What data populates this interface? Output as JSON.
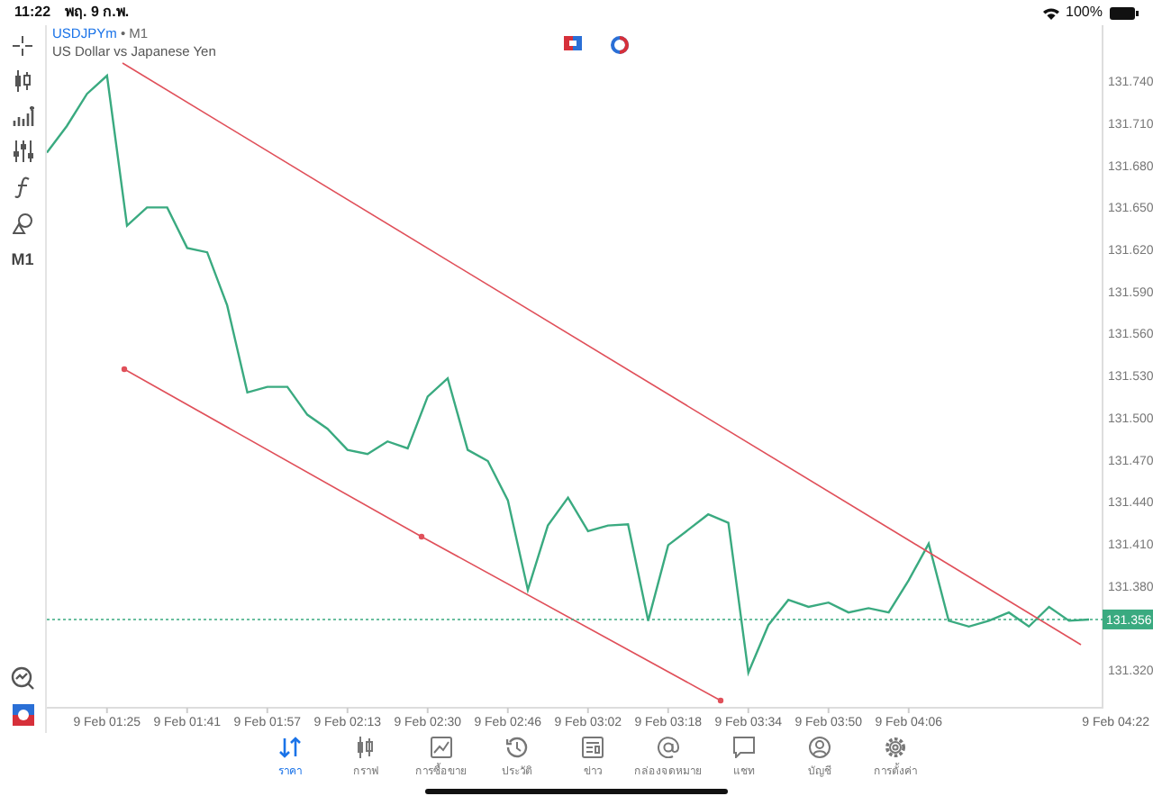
{
  "status_bar": {
    "time": "11:22",
    "date": "พฤ. 9 ก.พ.",
    "battery": "100%"
  },
  "left_toolbar": {
    "timeframe": "M1"
  },
  "chart": {
    "timeframe": "• M1",
    "description": "US Dollar vs Japanese Yen",
    "current_price": "131.356",
    "last_time_label": "9 Feb 04:22",
    "trend_lines": [
      {
        "color": "#e0505a",
        "anchors": false
      },
      {
        "color": "#e0505a",
        "anchors": true
      }
    ],
    "chart_data": {
      "type": "line",
      "ylim": [
        131.293,
        131.78
      ],
      "categories": [
        null,
        null,
        null,
        "9 Feb 01:25",
        null,
        null,
        null,
        "9 Feb 01:41",
        null,
        null,
        null,
        "9 Feb 01:57",
        null,
        null,
        null,
        "9 Feb 02:13",
        null,
        null,
        null,
        "9 Feb 02:30",
        null,
        null,
        null,
        "9 Feb 02:46",
        null,
        null,
        null,
        "9 Feb 03:02",
        null,
        null,
        null,
        "9 Feb 03:18",
        null,
        null,
        null,
        "9 Feb 03:34",
        null,
        null,
        null,
        "9 Feb 03:50",
        null,
        null,
        null,
        "9 Feb 04:06",
        null,
        null,
        null,
        null,
        null,
        null,
        null,
        null,
        null
      ],
      "series": [
        {
          "name": "USDJPYm",
          "color": "#3aaa80",
          "values": [
            131.689,
            131.708,
            131.731,
            131.744,
            131.637,
            131.65,
            131.65,
            131.621,
            131.618,
            131.58,
            131.518,
            131.522,
            131.522,
            131.502,
            131.492,
            131.477,
            131.474,
            131.483,
            131.478,
            131.515,
            131.528,
            131.477,
            131.469,
            131.441,
            131.377,
            131.423,
            131.443,
            131.419,
            131.423,
            131.424,
            131.355,
            131.409,
            131.42,
            131.431,
            131.425,
            131.318,
            131.352,
            131.37,
            131.365,
            131.368,
            131.361,
            131.364,
            131.361,
            131.384,
            131.41,
            131.355,
            131.351,
            131.355,
            131.361,
            131.351,
            131.365,
            131.355,
            131.356
          ]
        }
      ],
      "yticks": [
        {
          "value": 131.32,
          "label": "131.320"
        },
        {
          "value": 131.38,
          "label": "131.380"
        },
        {
          "value": 131.41,
          "label": "131.410"
        },
        {
          "value": 131.44,
          "label": "131.440"
        },
        {
          "value": 131.47,
          "label": "131.470"
        },
        {
          "value": 131.5,
          "label": "131.500"
        },
        {
          "value": 131.53,
          "label": "131.530"
        },
        {
          "value": 131.56,
          "label": "131.560"
        },
        {
          "value": 131.59,
          "label": "131.590"
        },
        {
          "value": 131.62,
          "label": "131.620"
        },
        {
          "value": 131.65,
          "label": "131.650"
        },
        {
          "value": 131.68,
          "label": "131.680"
        },
        {
          "value": 131.71,
          "label": "131.710"
        },
        {
          "value": 131.74,
          "label": "131.740"
        }
      ]
    }
  },
  "tabs": [
    {
      "label": "ราคา",
      "selected": true
    },
    {
      "label": "กราฟ",
      "selected": false
    },
    {
      "label": "การซื้อขาย",
      "selected": false
    },
    {
      "label": "ประวัติ",
      "selected": false
    },
    {
      "label": "ข่าว",
      "selected": false
    },
    {
      "label": "กล่องจดหมาย",
      "selected": false
    },
    {
      "label": "แชท",
      "selected": false
    },
    {
      "label": "บัญชี",
      "selected": false
    },
    {
      "label": "การตั้งค่า",
      "selected": false
    }
  ]
}
